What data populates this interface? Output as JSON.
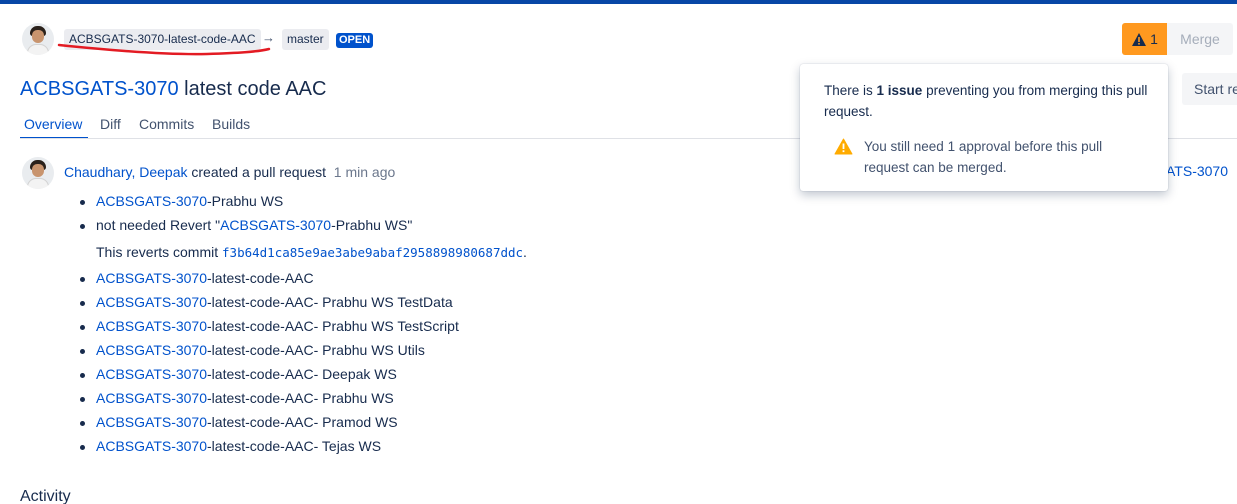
{
  "header": {
    "source_branch": "ACBSGATS-3070-latest-code-AAC",
    "arrow": "→",
    "target_branch": "master",
    "status": "OPEN"
  },
  "title": {
    "issue_key": "ACBSGATS-3070",
    "text": "latest code AAC"
  },
  "tabs": [
    {
      "label": "Overview"
    },
    {
      "label": "Diff"
    },
    {
      "label": "Commits"
    },
    {
      "label": "Builds"
    }
  ],
  "actions": {
    "warning_count": "1",
    "merge_label": "Merge",
    "start_label": "Start re",
    "background_link": "ATS-3070"
  },
  "popover": {
    "msg_prefix": "There is ",
    "msg_bold": "1 issue",
    "msg_suffix": " preventing you from merging this pull request.",
    "detail": "You still need 1 approval before this pull request can be merged."
  },
  "activity": {
    "author": "Chaudhary, Deepak",
    "action": "created a pull request",
    "time": "1 min ago"
  },
  "description": {
    "items": [
      {
        "link": "ACBSGATS-3070",
        "text": "-Prabhu WS"
      },
      {
        "prefix": "not needed Revert \"",
        "link": "ACBSGATS-3070",
        "text": "-Prabhu WS\""
      },
      {
        "link": "ACBSGATS-3070",
        "text": "-latest-code-AAC"
      },
      {
        "link": "ACBSGATS-3070",
        "text": "-latest-code-AAC- Prabhu WS TestData"
      },
      {
        "link": "ACBSGATS-3070",
        "text": "-latest-code-AAC- Prabhu WS TestScript"
      },
      {
        "link": "ACBSGATS-3070",
        "text": "-latest-code-AAC- Prabhu WS Utils"
      },
      {
        "link": "ACBSGATS-3070",
        "text": "-latest-code-AAC- Deepak WS"
      },
      {
        "link": "ACBSGATS-3070",
        "text": "-latest-code-AAC- Prabhu WS"
      },
      {
        "link": "ACBSGATS-3070",
        "text": "-latest-code-AAC- Pramod WS"
      },
      {
        "link": "ACBSGATS-3070",
        "text": "-latest-code-AAC- Tejas WS"
      }
    ],
    "revert_text": "This reverts commit ",
    "revert_commit": "f3b64d1ca85e9ae3abe9abaf2958898980687ddc",
    "revert_end": "."
  },
  "section": {
    "activity_heading": "Activity"
  },
  "colors": {
    "brand": "#0747a6",
    "link": "#0052cc",
    "warning": "#ff991f",
    "annotation": "#e31b23"
  },
  "icons": {
    "warning": "warning-triangle-icon",
    "avatar": "user-avatar"
  }
}
